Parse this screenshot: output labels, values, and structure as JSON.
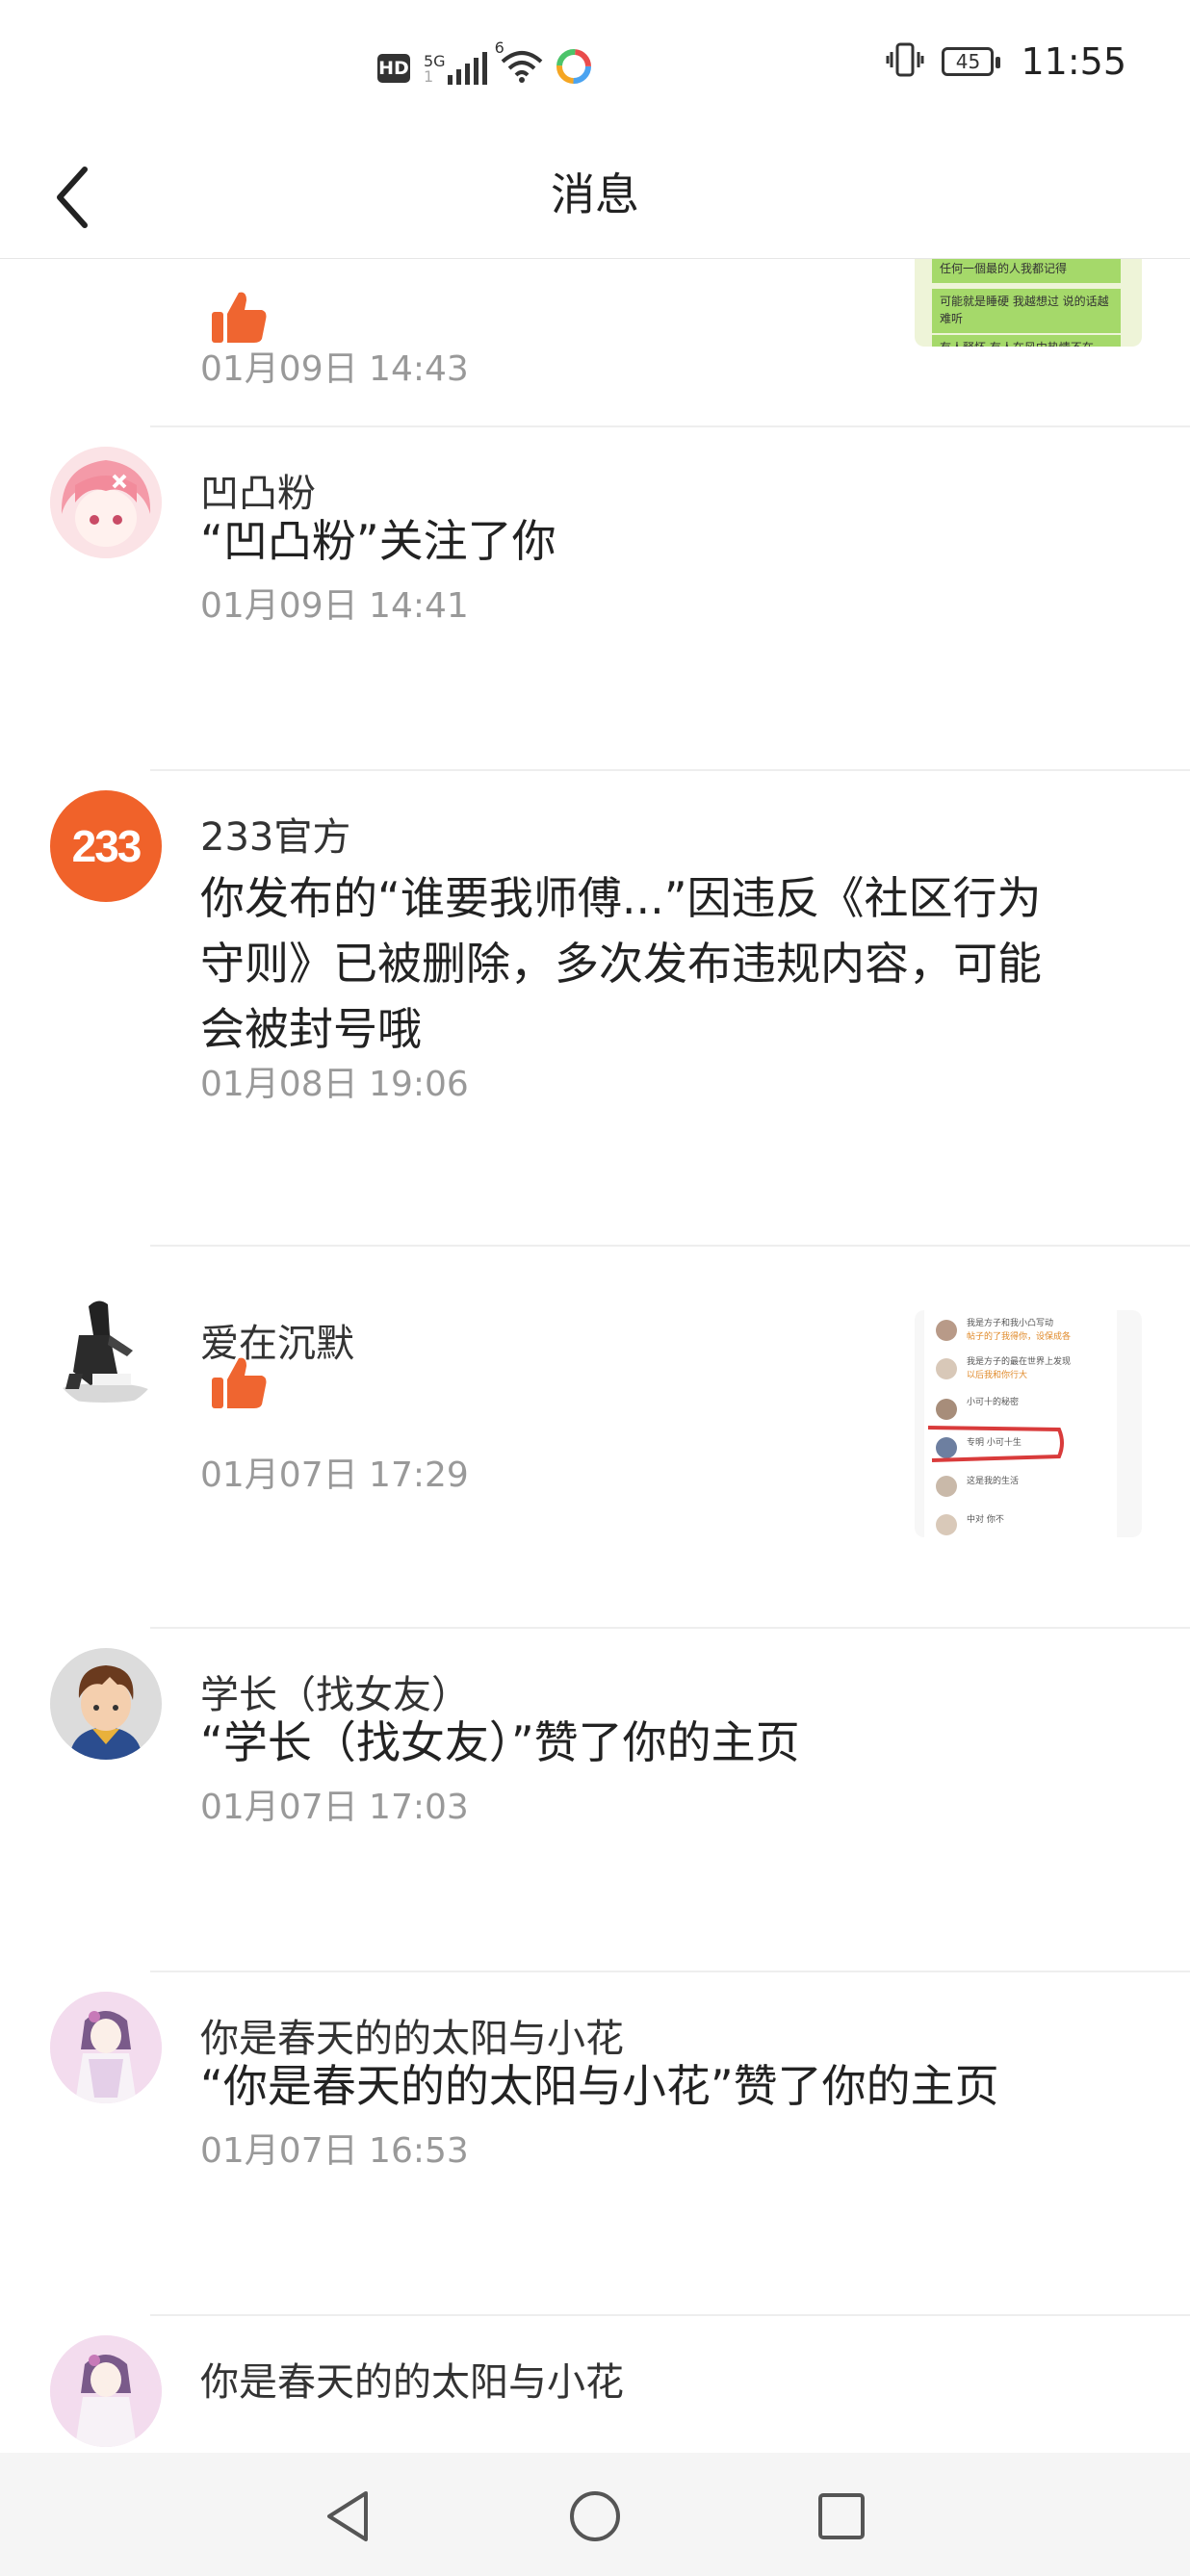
{
  "status_bar": {
    "hd": "HD",
    "network": "5G",
    "network_sub": "1",
    "wifi_sup": "6",
    "battery": "45",
    "time": "11:55"
  },
  "header": {
    "title": "消息"
  },
  "messages": [
    {
      "type": "like",
      "time": "01月09日 14:43",
      "has_thumbnail": true
    },
    {
      "name": "凹凸粉",
      "text": "“凹凸粉”关注了你",
      "time": "01月09日 14:41"
    },
    {
      "name": "233官方",
      "avatar_text": "233",
      "text": "你发布的“谁要我师傅...”因违反《社区行为守则》已被删除，多次发布违规内容，可能会被封号哦",
      "time": "01月08日 19:06"
    },
    {
      "name": "爱在沉默",
      "type": "like",
      "time": "01月07日 17:29",
      "has_thumbnail": true
    },
    {
      "name": "学长（找女友）",
      "text": "“学长（找女友）”赞了你的主页",
      "time": "01月07日 17:03"
    },
    {
      "name": "你是春天的的太阳与小花",
      "text": "“你是春天的的太阳与小花”赞了你的主页",
      "time": "01月07日 16:53"
    },
    {
      "name": "你是春天的的太阳与小花"
    }
  ],
  "thumbnail_1": {
    "lines": [
      "任何一個最的人我都记得",
      "可能就是睡硬 我越想过 说的话越",
      "难听",
      "有人释怀 有人在风中热情不在"
    ]
  },
  "thumbnail_2": {
    "rows": [
      "我是方子和我小凸写动",
      "帖子的了我得你，设保成各",
      "我是方子的最在世界上发现",
      "以后我和你行大",
      "小可十的秘密",
      "专明 小可十生",
      "这是我的生活",
      "中对 你不"
    ]
  },
  "colors": {
    "accent": "#f0622a",
    "like_icon": "#ef6530",
    "time_text": "#999999",
    "divider": "#eeeeee"
  },
  "nav_buttons": [
    "back-triangle-icon",
    "home-circle-icon",
    "recents-square-icon"
  ]
}
